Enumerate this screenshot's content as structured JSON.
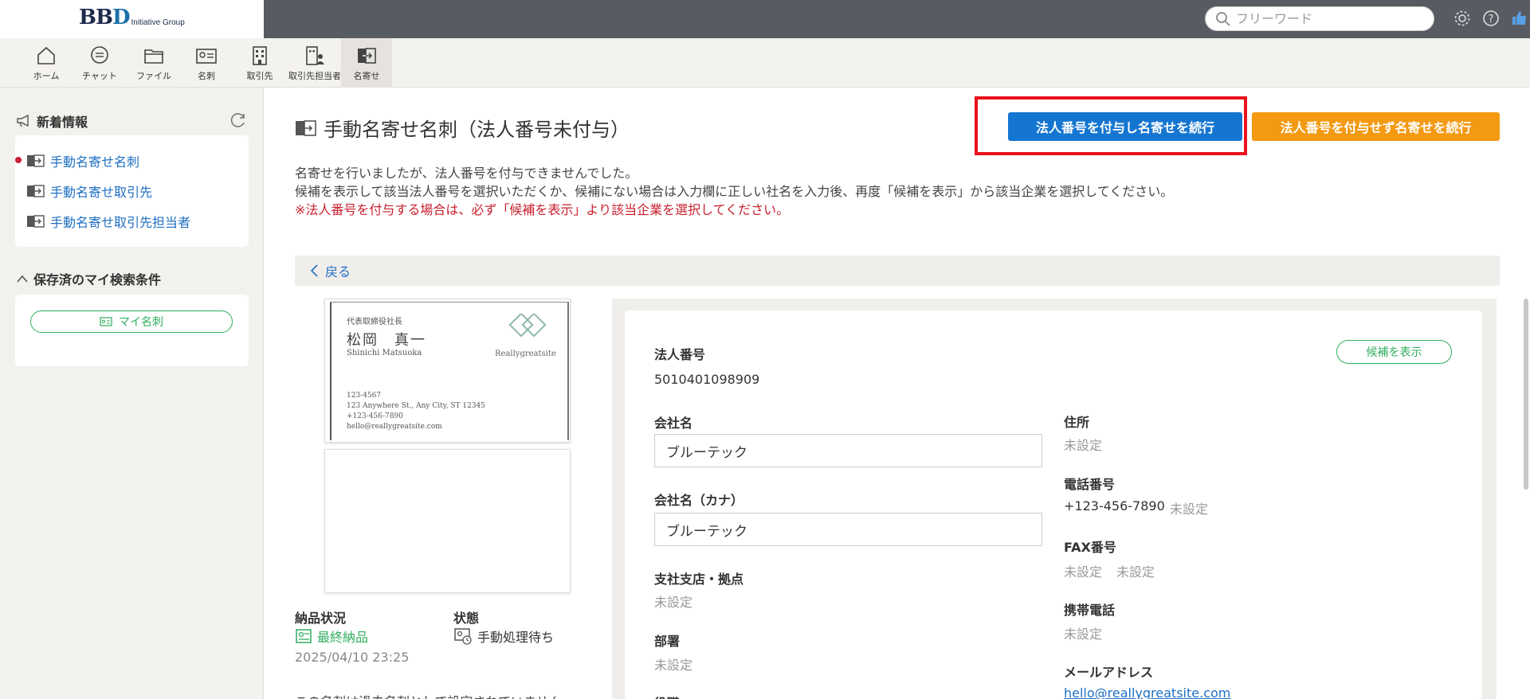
{
  "brand": {
    "mark_a": "BB",
    "mark_b": "D",
    "sub": "Initiative Group"
  },
  "search": {
    "placeholder": "フリーワード"
  },
  "nav": [
    {
      "label": "ホーム",
      "icon": "home-icon"
    },
    {
      "label": "チャット",
      "icon": "chat-icon"
    },
    {
      "label": "ファイル",
      "icon": "folder-icon"
    },
    {
      "label": "名刺",
      "icon": "business-card-icon"
    },
    {
      "label": "取引先",
      "icon": "building-icon"
    },
    {
      "label": "取引先担当者",
      "icon": "contact-building-icon"
    },
    {
      "label": "名寄せ",
      "icon": "merge-icon"
    }
  ],
  "sidebar": {
    "news_title": "新着情報",
    "news_items": [
      "手動名寄せ名刺",
      "手動名寄せ取引先",
      "手動名寄せ取引先担当者"
    ],
    "saved_title": "保存済のマイ検索条件",
    "my_card_label": "マイ名刺"
  },
  "page": {
    "title": "手動名寄せ名刺（法人番号未付与）",
    "btn_continue_with": "法人番号を付与し名寄せを続行",
    "btn_continue_without": "法人番号を付与せず名寄せを続行",
    "desc1": "名寄せを行いましたが、法人番号を付与できませんでした。",
    "desc2": "候補を表示して該当法人番号を選択いただくか、候補にない場合は入力欄に正しい社名を入力後、再度「候補を表示」から該当企業を選択してください。",
    "warn": "※法人番号を付与する場合は、必ず「候補を表示」より該当企業を選択してください。",
    "back": "戻る"
  },
  "card": {
    "title": "代表取締役社長",
    "name": "松岡　真一",
    "roman": "Shinichi Matsuoka",
    "company": "Reallygreatsite",
    "lines": [
      "123-4567",
      "123 Anywhere St., Any City, ST 12345",
      "+123-456-7890",
      "hello@reallygreatsite.com"
    ]
  },
  "status": {
    "delivery_label": "納品状況",
    "delivery_value": "最終納品",
    "state_label": "状態",
    "state_value": "手動処理待ち",
    "date": "2025/04/10 23:25",
    "cut_text": "この名刺は過去名刺として設定されていません"
  },
  "detail": {
    "corp_no_label": "法人番号",
    "corp_no": "5010401098909",
    "show_candidates": "候補を表示",
    "company_label": "会社名",
    "company_value": "ブルーテック",
    "company_kana_label": "会社名（カナ）",
    "company_kana_value": "ブルーテック",
    "branch_label": "支社支店・拠点",
    "branch_value": "未設定",
    "dept_label": "部署",
    "dept_value": "未設定",
    "title_label": "役職",
    "address_label": "住所",
    "address_value": "未設定",
    "tel_label": "電話番号",
    "tel_value": "+123-456-7890",
    "tel_ext": "未設定",
    "fax_label": "FAX番号",
    "fax_value1": "未設定",
    "fax_value2": "未設定",
    "mobile_label": "携帯電話",
    "mobile_value": "未設定",
    "email_label": "メールアドレス",
    "email_value": "hello@reallygreatsite.com"
  },
  "colors": {
    "primary": "#1576d1",
    "orange": "#f39a12",
    "green": "#2fae5e",
    "warn": "#c8202e",
    "highlight": "#e8121d"
  }
}
